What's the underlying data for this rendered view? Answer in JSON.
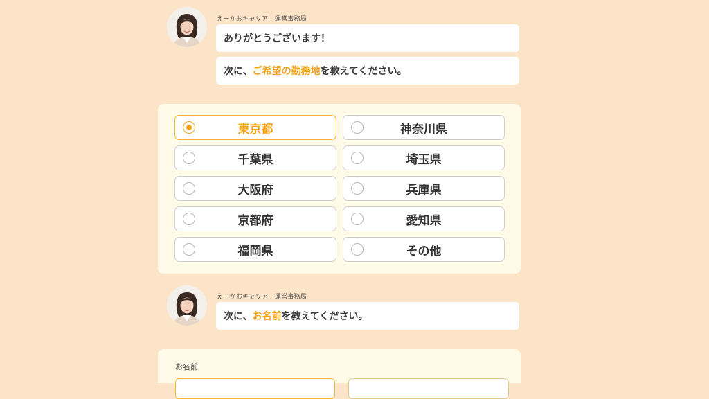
{
  "colors": {
    "page_background": "#fbe4c8",
    "accent": "#f5a31a",
    "panel_background": "#fffbe8",
    "bubble_background": "#ffffff"
  },
  "chat_1": {
    "avatar_icon": "operator-avatar",
    "sender": "えーかおキャリア　運営事務局",
    "message_1": "ありがとうございます！",
    "message_2": {
      "prefix": "次に、",
      "highlight": "ご希望の勤務地",
      "suffix": "を教えてください。"
    }
  },
  "location_options": [
    {
      "label": "東京都",
      "selected": true
    },
    {
      "label": "神奈川県",
      "selected": false
    },
    {
      "label": "千葉県",
      "selected": false
    },
    {
      "label": "埼玉県",
      "selected": false
    },
    {
      "label": "大阪府",
      "selected": false
    },
    {
      "label": "兵庫県",
      "selected": false
    },
    {
      "label": "京都府",
      "selected": false
    },
    {
      "label": "愛知県",
      "selected": false
    },
    {
      "label": "福岡県",
      "selected": false
    },
    {
      "label": "その他",
      "selected": false
    }
  ],
  "chat_2": {
    "avatar_icon": "operator-avatar",
    "sender": "えーかおキャリア　運営事務局",
    "message": {
      "prefix": "次に、",
      "highlight": "お名前",
      "suffix": "を教えてください。"
    }
  },
  "name_form": {
    "label": "お名前",
    "last_name_value": "",
    "first_name_value": ""
  }
}
